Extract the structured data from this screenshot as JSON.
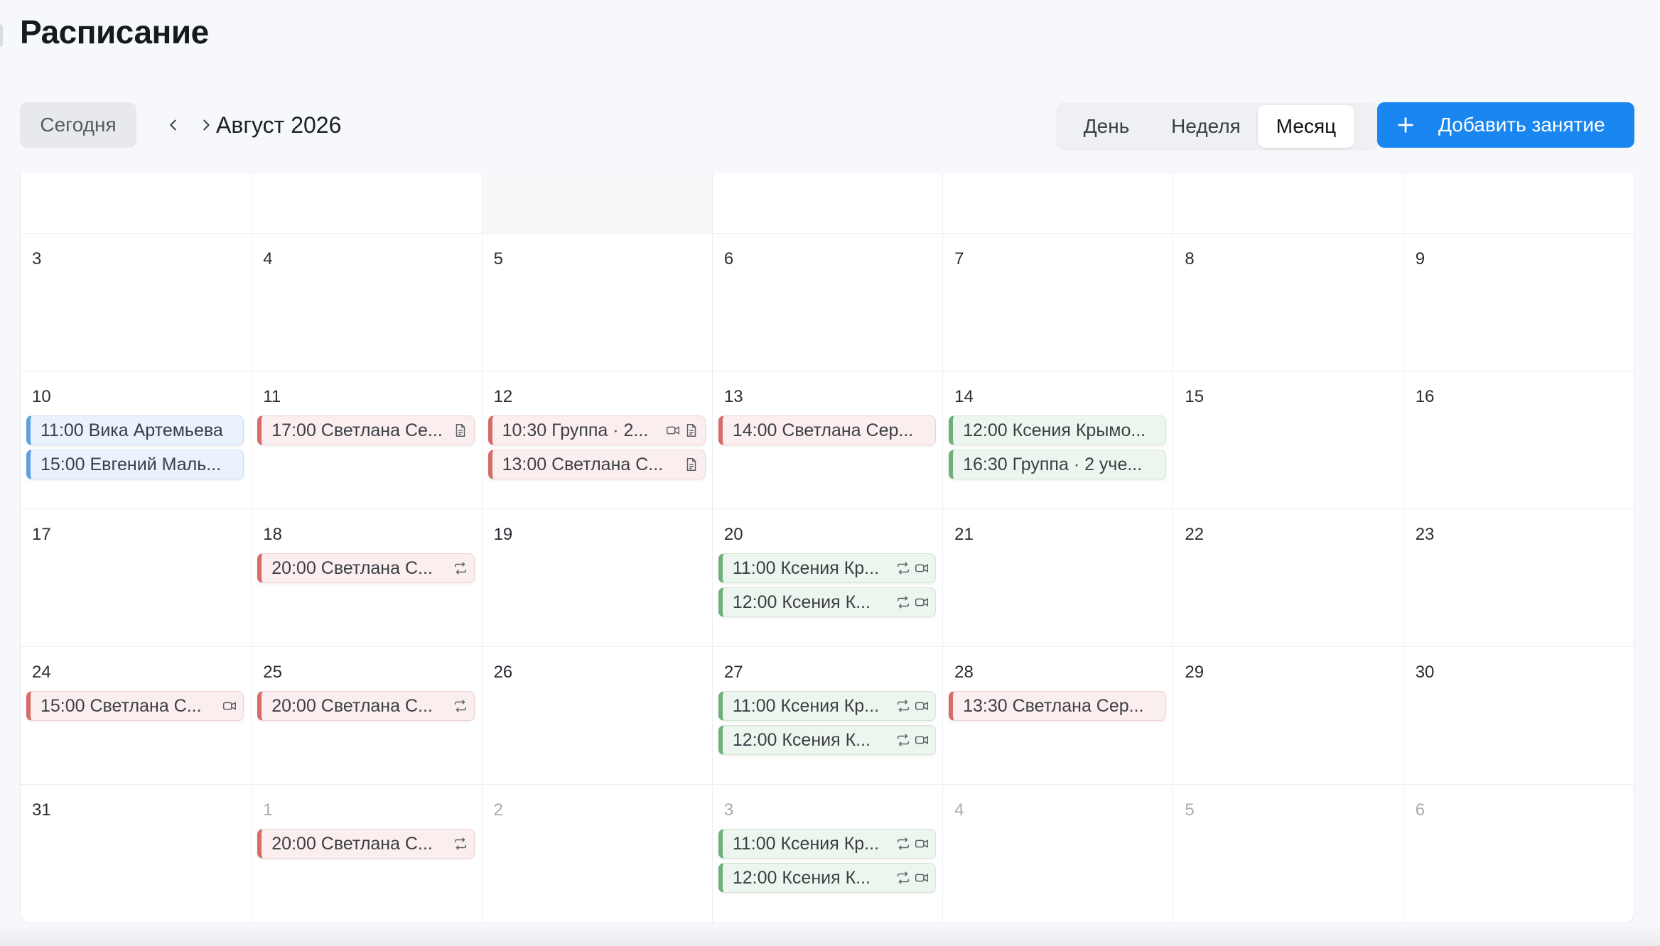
{
  "page": {
    "title": "Расписание"
  },
  "toolbar": {
    "today_label": "Сегодня",
    "month_label": "Август 2026",
    "views": {
      "day": "День",
      "week": "Неделя",
      "month": "Месяц"
    },
    "active_view": "Месяц",
    "add_label": "Добавить занятие"
  },
  "colors": {
    "accent": "#1a87f0",
    "blue": "#5ea0df",
    "red": "#d56b6b",
    "green": "#6fb07a"
  },
  "weeks": [
    {
      "days": [
        {
          "num": ""
        },
        {
          "num": ""
        },
        {
          "num": ""
        },
        {
          "num": ""
        },
        {
          "num": ""
        },
        {
          "num": ""
        },
        {
          "num": ""
        }
      ]
    },
    {
      "days": [
        {
          "num": "3"
        },
        {
          "num": "4"
        },
        {
          "num": "5"
        },
        {
          "num": "6"
        },
        {
          "num": "7"
        },
        {
          "num": "8"
        },
        {
          "num": "9"
        }
      ]
    },
    {
      "days": [
        {
          "num": "10",
          "events": [
            {
              "text": "11:00 Вика Артемьева",
              "color": "blue",
              "icons": []
            },
            {
              "text": "15:00 Евгений Маль...",
              "color": "blue",
              "icons": []
            }
          ]
        },
        {
          "num": "11",
          "events": [
            {
              "text": "17:00 Светлана Се...",
              "color": "red",
              "icons": [
                "note-icon"
              ]
            }
          ]
        },
        {
          "num": "12",
          "events": [
            {
              "text": "10:30 Группа · 2...",
              "color": "red",
              "icons": [
                "video-icon",
                "note-icon"
              ]
            },
            {
              "text": "13:00 Светлана С...",
              "color": "red",
              "icons": [
                "note-icon"
              ]
            }
          ]
        },
        {
          "num": "13",
          "events": [
            {
              "text": "14:00 Светлана Сер...",
              "color": "red",
              "icons": []
            }
          ]
        },
        {
          "num": "14",
          "events": [
            {
              "text": "12:00 Ксения Крымо...",
              "color": "green",
              "icons": []
            },
            {
              "text": "16:30 Группа · 2 уче...",
              "color": "green",
              "icons": []
            }
          ]
        },
        {
          "num": "15"
        },
        {
          "num": "16"
        }
      ]
    },
    {
      "days": [
        {
          "num": "17"
        },
        {
          "num": "18",
          "events": [
            {
              "text": "20:00 Светлана С...",
              "color": "red",
              "icons": [
                "repeat-icon"
              ]
            }
          ]
        },
        {
          "num": "19"
        },
        {
          "num": "20",
          "events": [
            {
              "text": "11:00 Ксения Кр...",
              "color": "green",
              "icons": [
                "repeat-icon",
                "video-icon"
              ]
            },
            {
              "text": "12:00 Ксения К...",
              "color": "green",
              "icons": [
                "repeat-icon",
                "video-icon"
              ]
            }
          ]
        },
        {
          "num": "21"
        },
        {
          "num": "22"
        },
        {
          "num": "23"
        }
      ]
    },
    {
      "days": [
        {
          "num": "24",
          "events": [
            {
              "text": "15:00 Светлана С...",
              "color": "red",
              "icons": [
                "video-icon"
              ]
            }
          ]
        },
        {
          "num": "25",
          "events": [
            {
              "text": "20:00 Светлана С...",
              "color": "red",
              "icons": [
                "repeat-icon"
              ]
            }
          ]
        },
        {
          "num": "26"
        },
        {
          "num": "27",
          "events": [
            {
              "text": "11:00 Ксения Кр...",
              "color": "green",
              "icons": [
                "repeat-icon",
                "video-icon"
              ]
            },
            {
              "text": "12:00 Ксения К...",
              "color": "green",
              "icons": [
                "repeat-icon",
                "video-icon"
              ]
            }
          ]
        },
        {
          "num": "28",
          "events": [
            {
              "text": "13:30 Светлана Сер...",
              "color": "red",
              "icons": []
            }
          ]
        },
        {
          "num": "29"
        },
        {
          "num": "30"
        }
      ]
    },
    {
      "days": [
        {
          "num": "31"
        },
        {
          "num": "1",
          "muted": true,
          "events": [
            {
              "text": "20:00 Светлана С...",
              "color": "red",
              "icons": [
                "repeat-icon"
              ]
            }
          ]
        },
        {
          "num": "2",
          "muted": true
        },
        {
          "num": "3",
          "muted": true,
          "events": [
            {
              "text": "11:00 Ксения Кр...",
              "color": "green",
              "icons": [
                "repeat-icon",
                "video-icon"
              ]
            },
            {
              "text": "12:00 Ксения К...",
              "color": "green",
              "icons": [
                "repeat-icon",
                "video-icon"
              ]
            }
          ]
        },
        {
          "num": "4",
          "muted": true
        },
        {
          "num": "5",
          "muted": true
        },
        {
          "num": "6",
          "muted": true
        }
      ]
    }
  ]
}
